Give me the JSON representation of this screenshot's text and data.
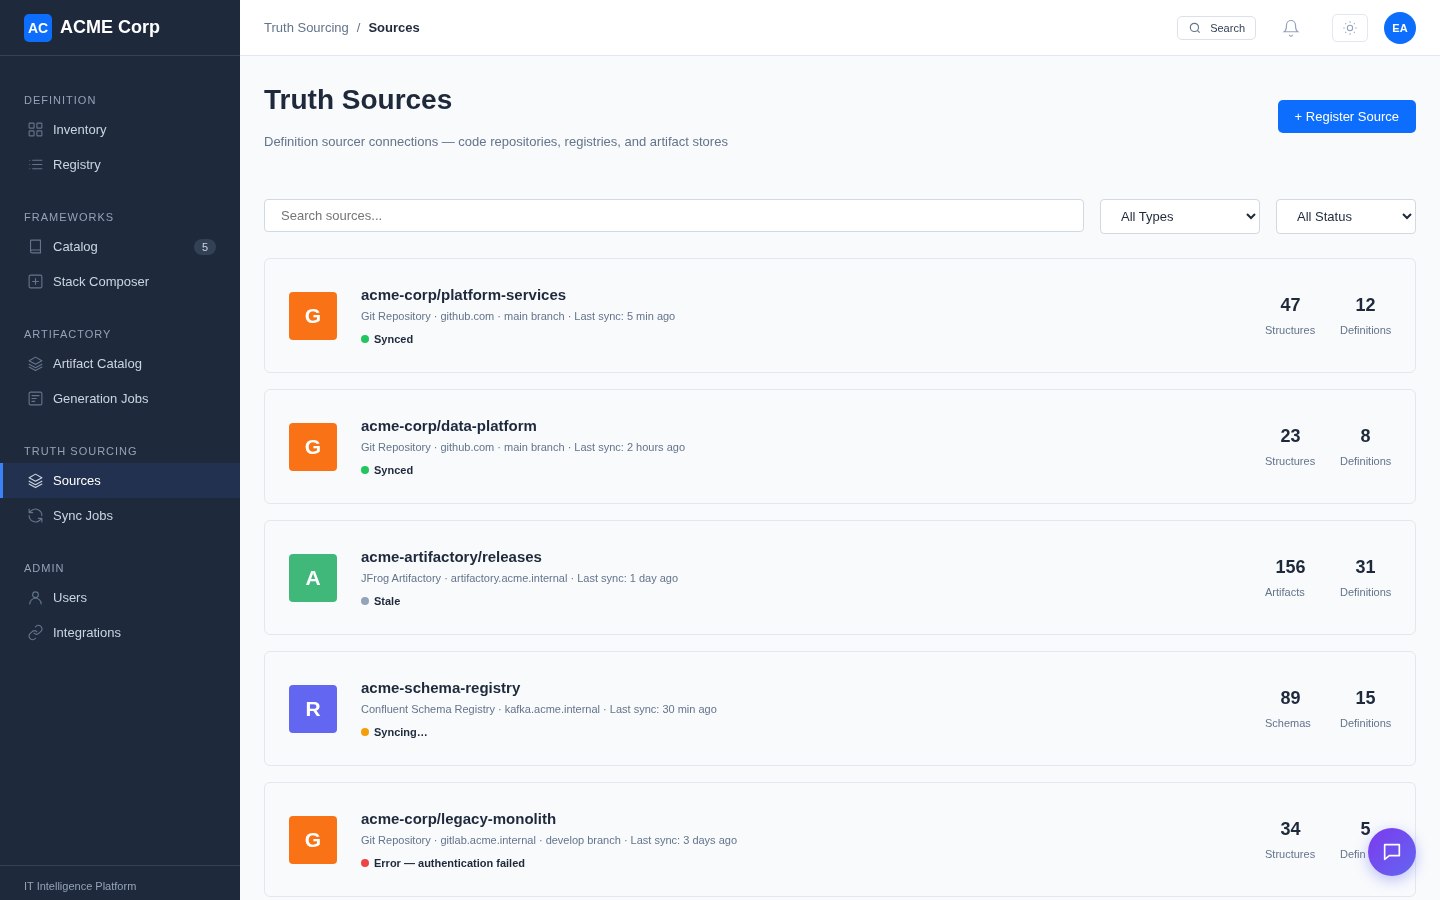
{
  "brand": {
    "mark": "AC",
    "name": "ACME Corp"
  },
  "sidebar": {
    "sections": [
      {
        "title": "DEFINITION",
        "items": [
          {
            "label": "Inventory",
            "selected": false
          },
          {
            "label": "Registry",
            "selected": false
          }
        ]
      },
      {
        "title": "FRAMEWORKS",
        "items": [
          {
            "label": "Catalog",
            "selected": false,
            "badge": "5"
          },
          {
            "label": "Stack Composer",
            "selected": false
          }
        ]
      },
      {
        "title": "ARTIFACTORY",
        "items": [
          {
            "label": "Artifact Catalog",
            "selected": false
          },
          {
            "label": "Generation Jobs",
            "selected": false
          }
        ]
      },
      {
        "title": "TRUTH SOURCING",
        "items": [
          {
            "label": "Sources",
            "selected": true
          },
          {
            "label": "Sync Jobs",
            "selected": false
          }
        ]
      },
      {
        "title": "ADMIN",
        "items": [
          {
            "label": "Users",
            "selected": false
          },
          {
            "label": "Integrations",
            "selected": false
          }
        ]
      }
    ],
    "footer": "IT Intelligence Platform"
  },
  "breadcrumb": [
    "Truth Sourcing",
    "/",
    "Sources"
  ],
  "topbar": {
    "search": "Search",
    "avatar": "EA"
  },
  "page": {
    "title": "Truth Sources",
    "subtitle": "Definition sourcer connections — code repositories, registries, and artifact stores",
    "action": "+ Register Source"
  },
  "filters": {
    "search_placeholder": "Search sources...",
    "type": "All Types",
    "status": "All Status"
  },
  "sources": [
    {
      "letter": "G",
      "color": "#f97316",
      "name": "acme-corp/platform-services",
      "meta": "Git Repository · github.com · main branch · Last sync: 5 min ago",
      "status": {
        "label": "Synced",
        "color": "#22c55e"
      },
      "stats": [
        {
          "value": "47",
          "label": "Structures"
        },
        {
          "value": "12",
          "label": "Definitions"
        }
      ]
    },
    {
      "letter": "G",
      "color": "#f97316",
      "name": "acme-corp/data-platform",
      "meta": "Git Repository · github.com · main branch · Last sync: 2 hours ago",
      "status": {
        "label": "Synced",
        "color": "#22c55e"
      },
      "stats": [
        {
          "value": "23",
          "label": "Structures"
        },
        {
          "value": "8",
          "label": "Definitions"
        }
      ]
    },
    {
      "letter": "A",
      "color": "#3fb87a",
      "name": "acme-artifactory/releases",
      "meta": "JFrog Artifactory · artifactory.acme.internal · Last sync: 1 day ago",
      "status": {
        "label": "Stale",
        "color": "#94a3b8"
      },
      "stats": [
        {
          "value": "156",
          "label": "Artifacts"
        },
        {
          "value": "31",
          "label": "Definitions"
        }
      ]
    },
    {
      "letter": "R",
      "color": "#6366f1",
      "name": "acme-schema-registry",
      "meta": "Confluent Schema Registry · kafka.acme.internal · Last sync: 30 min ago",
      "status": {
        "label": "Syncing…",
        "color": "#f59e0b"
      },
      "stats": [
        {
          "value": "89",
          "label": "Schemas"
        },
        {
          "value": "15",
          "label": "Definitions"
        }
      ]
    },
    {
      "letter": "G",
      "color": "#f97316",
      "name": "acme-corp/legacy-monolith",
      "meta": "Git Repository · gitlab.acme.internal · develop branch · Last sync: 3 days ago",
      "status": {
        "label": "Error — authentication failed",
        "color": "#ef4444"
      },
      "stats": [
        {
          "value": "34",
          "label": "Structures"
        },
        {
          "value": "5",
          "label": "Defin"
        }
      ]
    }
  ]
}
